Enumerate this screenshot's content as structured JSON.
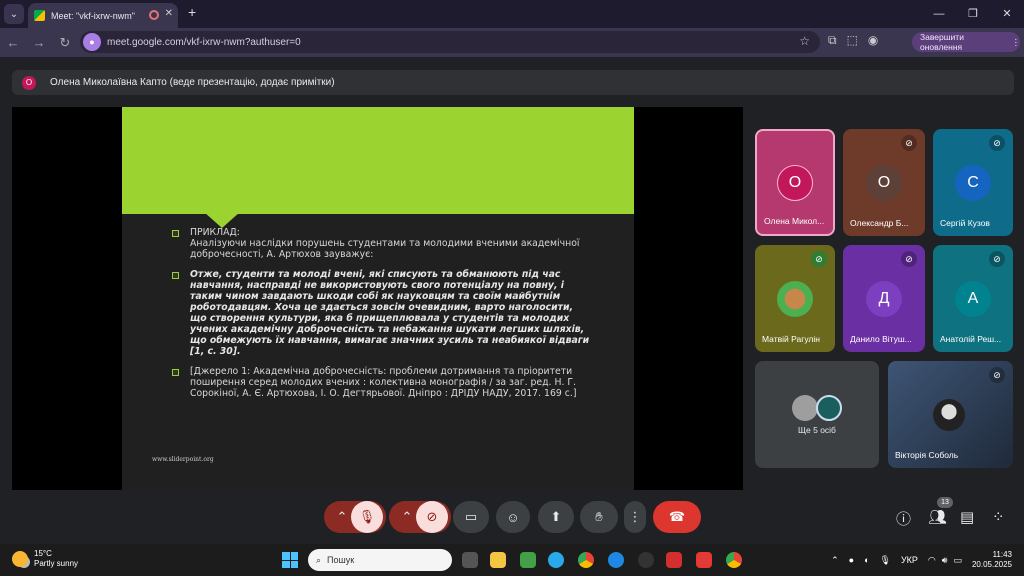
{
  "browser": {
    "tab_title": "Meet: \"vkf-ixrw-nwm\"",
    "url": "meet.google.com/vkf-ixrw-nwm?authuser=0",
    "update_label": "Завершити оновлення"
  },
  "presenter": {
    "initial": "О",
    "text": "Олена Миколаївна Капто (веде презентацію, додає примітки)"
  },
  "slide": {
    "bullets": [
      {
        "text": "ПРИКЛАД:\nАналізуючи наслідки порушень студентами та молодими вченими академічної доброчесності, А. Артюхов зауважує:",
        "bold": false
      },
      {
        "text": "Отже, студенти та молоді вчені, які списують та обманюють під час навчання, насправді не використовують свого потенціалу на повну, і таким чином завдають шкоди собі як науковцям та своїм майбутнім роботодавцям. Хоча це здається зовсім очевидним, варто наголосити, що створення культури, яка б прищеплювала у студентів та молодих учених академічну доброчесність та небажання шукати легших шляхів, що обмежують їх навчання, вимагає значних зусиль та неабиякої відваги [1, с. 30].",
        "bold": true
      },
      {
        "text": "[Джерело 1: Академічна доброчесність: проблеми дотримання та пріоритети поширення серед молодих вчених : колективна монографія / за заг. ред. Н. Г. Сорокіної, А. Є. Артюхова, І. О. Дегтярьової. Дніпро : ДРІДУ НАДУ, 2017. 169 с.]",
        "bold": false
      }
    ],
    "footer": "www.sliderpoint.org"
  },
  "participants": [
    {
      "initial": "О",
      "name": "Олена Микол...",
      "muted": false,
      "color": "#b5386e",
      "avatar_color": "#c2185b"
    },
    {
      "initial": "О",
      "name": "Олександр Б...",
      "muted": true,
      "color": "#6e3b2b",
      "avatar_color": "#5d4037"
    },
    {
      "initial": "С",
      "name": "Сергій Кузов",
      "muted": true,
      "color": "#0f6b8a",
      "avatar_color": "#1565c0"
    },
    {
      "initial": "",
      "name": "Матвій Рагулін",
      "muted": true,
      "color": "#6b6a1c",
      "avatar_color": "#2e7d32"
    },
    {
      "initial": "Д",
      "name": "Данило Вітуш...",
      "muted": true,
      "color": "#6a2fa3",
      "avatar_color": "#7b3fc0"
    },
    {
      "initial": "А",
      "name": "Анатолій Реш...",
      "muted": true,
      "color": "#0f7280",
      "avatar_color": "#00838f"
    }
  ],
  "others_label": "Ще 5 осіб",
  "victoria": {
    "name": "Вікторія Соболь"
  },
  "people_count": "13",
  "taskbar": {
    "temp": "15°C",
    "weather": "Partly sunny",
    "search_placeholder": "Пошук",
    "lang": "УКР",
    "time": "11:43",
    "date": "20.05.2025"
  }
}
